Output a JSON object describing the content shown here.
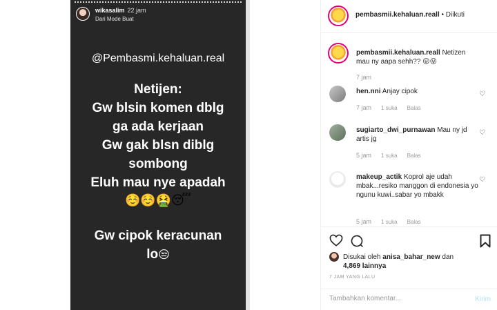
{
  "story": {
    "username": "wikasalim",
    "time": "22 jam",
    "subtitle": "Dari Mode Buat",
    "handle": "@Pembasmi.kehaluan.real",
    "lines_a": [
      "Netijen:",
      "Gw blsin komen dblg",
      "ga ada kerjaan",
      "Gw gak blsn diblg",
      "sombong",
      "Eluh mau nye apadah"
    ],
    "emoji_row": "☺️☺️🤮😴",
    "line_b1": "Gw cipok keracunan",
    "line_b2": "lo",
    "line_b2_emoji": "😒"
  },
  "header": {
    "account": "pembasmii.kehaluan.reall",
    "separator": " • ",
    "follow_label": "Diikuti"
  },
  "caption": {
    "account": "pembasmii.kehaluan.reall",
    "text": "Netizen mau ny aapa sehh?? 😛😛",
    "time": "7 jam"
  },
  "comments": [
    {
      "user": "hen.nni",
      "text": "Anjay cipok",
      "time": "7 jam",
      "likes": "1 suka",
      "reply": "Balas"
    },
    {
      "user": "sugiarto_dwi_purnawan",
      "text": "Mau ny jd artis jg",
      "time": "5 jam",
      "likes": "1 suka",
      "reply": "Balas"
    },
    {
      "user": "makeup_actik",
      "text": "Koprol aje udah mbak...resiko manggon di endonesia yo ngunu kuwi..sabar yo mbakk",
      "time": "5 jam",
      "likes": "1 suka",
      "reply": "Balas"
    }
  ],
  "likes": {
    "prefix": "Disukai oleh",
    "user": "anisa_bahar_new",
    "conj": "dan",
    "count": "4,869 lainnya"
  },
  "time_ago": "7 JAM YANG LALU",
  "add_comment": {
    "placeholder": "Tambahkan komentar...",
    "post_label": "Kirim"
  },
  "icons": {
    "heart": "heart-icon",
    "comment": "comment-bubble-icon",
    "save": "bookmark-icon"
  }
}
